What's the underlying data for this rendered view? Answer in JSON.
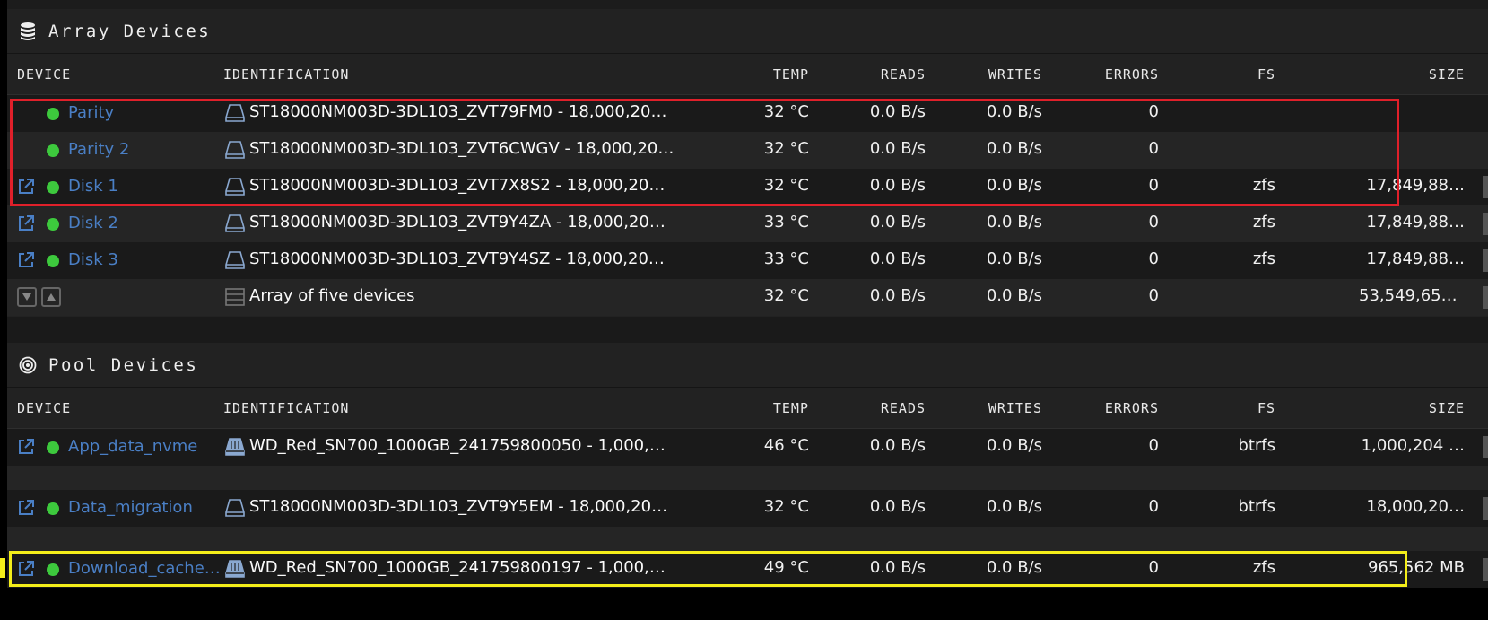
{
  "colors": {
    "link": "#4a7fc5",
    "status_ok": "#3dc93d",
    "highlight_red": "#e0202a",
    "highlight_yellow": "#f4ee1a"
  },
  "array": {
    "title": "Array Devices",
    "icon": "database-icon",
    "headers": {
      "device": "DEVICE",
      "identification": "IDENTIFICATION",
      "temp": "TEMP",
      "reads": "READS",
      "writes": "WRITES",
      "errors": "ERRORS",
      "fs": "FS",
      "size": "SIZE"
    },
    "rows": [
      {
        "name": "Parity",
        "ident": "ST18000NM003D-3DL103_ZVT79FM0 - 18,000,20…",
        "temp": "32 °C",
        "reads": "0.0 B/s",
        "writes": "0.0 B/s",
        "errors": "0",
        "fs": "",
        "size": ""
      },
      {
        "name": "Parity 2",
        "ident": "ST18000NM003D-3DL103_ZVT6CWGV - 18,000,20…",
        "temp": "32 °C",
        "reads": "0.0 B/s",
        "writes": "0.0 B/s",
        "errors": "0",
        "fs": "",
        "size": ""
      },
      {
        "name": "Disk 1",
        "ident": "ST18000NM003D-3DL103_ZVT7X8S2 - 18,000,20…",
        "temp": "32 °C",
        "reads": "0.0 B/s",
        "writes": "0.0 B/s",
        "errors": "0",
        "fs": "zfs",
        "size": "17,849,88…"
      },
      {
        "name": "Disk 2",
        "ident": "ST18000NM003D-3DL103_ZVT9Y4ZA - 18,000,20…",
        "temp": "33 °C",
        "reads": "0.0 B/s",
        "writes": "0.0 B/s",
        "errors": "0",
        "fs": "zfs",
        "size": "17,849,88…"
      },
      {
        "name": "Disk 3",
        "ident": "ST18000NM003D-3DL103_ZVT9Y4SZ - 18,000,20…",
        "temp": "33 °C",
        "reads": "0.0 B/s",
        "writes": "0.0 B/s",
        "errors": "0",
        "fs": "zfs",
        "size": "17,849,88…"
      }
    ],
    "summary": {
      "ident": "Array of five devices",
      "temp": "32 °C",
      "reads": "0.0 B/s",
      "writes": "0.0 B/s",
      "errors": "0",
      "size": "53,549,652…"
    }
  },
  "pool": {
    "title": "Pool Devices",
    "icon": "target-icon",
    "headers": {
      "device": "DEVICE",
      "identification": "IDENTIFICATION",
      "temp": "TEMP",
      "reads": "READS",
      "writes": "WRITES",
      "errors": "ERRORS",
      "fs": "FS",
      "size": "SIZE"
    },
    "rows": [
      {
        "name": "App_data_nvme",
        "ident": "WD_Red_SN700_1000GB_241759800050 - 1,000,…",
        "temp": "46 °C",
        "reads": "0.0 B/s",
        "writes": "0.0 B/s",
        "errors": "0",
        "fs": "btrfs",
        "size": "1,000,204 …"
      },
      {
        "name": "Data_migration",
        "ident": "ST18000NM003D-3DL103_ZVT9Y5EM - 18,000,20…",
        "temp": "32 °C",
        "reads": "0.0 B/s",
        "writes": "0.0 B/s",
        "errors": "0",
        "fs": "btrfs",
        "size": "18,000,20…"
      },
      {
        "name": "Download_cache…",
        "ident": "WD_Red_SN700_1000GB_241759800197 - 1,000,…",
        "temp": "49 °C",
        "reads": "0.0 B/s",
        "writes": "0.0 B/s",
        "errors": "0",
        "fs": "zfs",
        "size": "965,562 MB"
      }
    ]
  }
}
